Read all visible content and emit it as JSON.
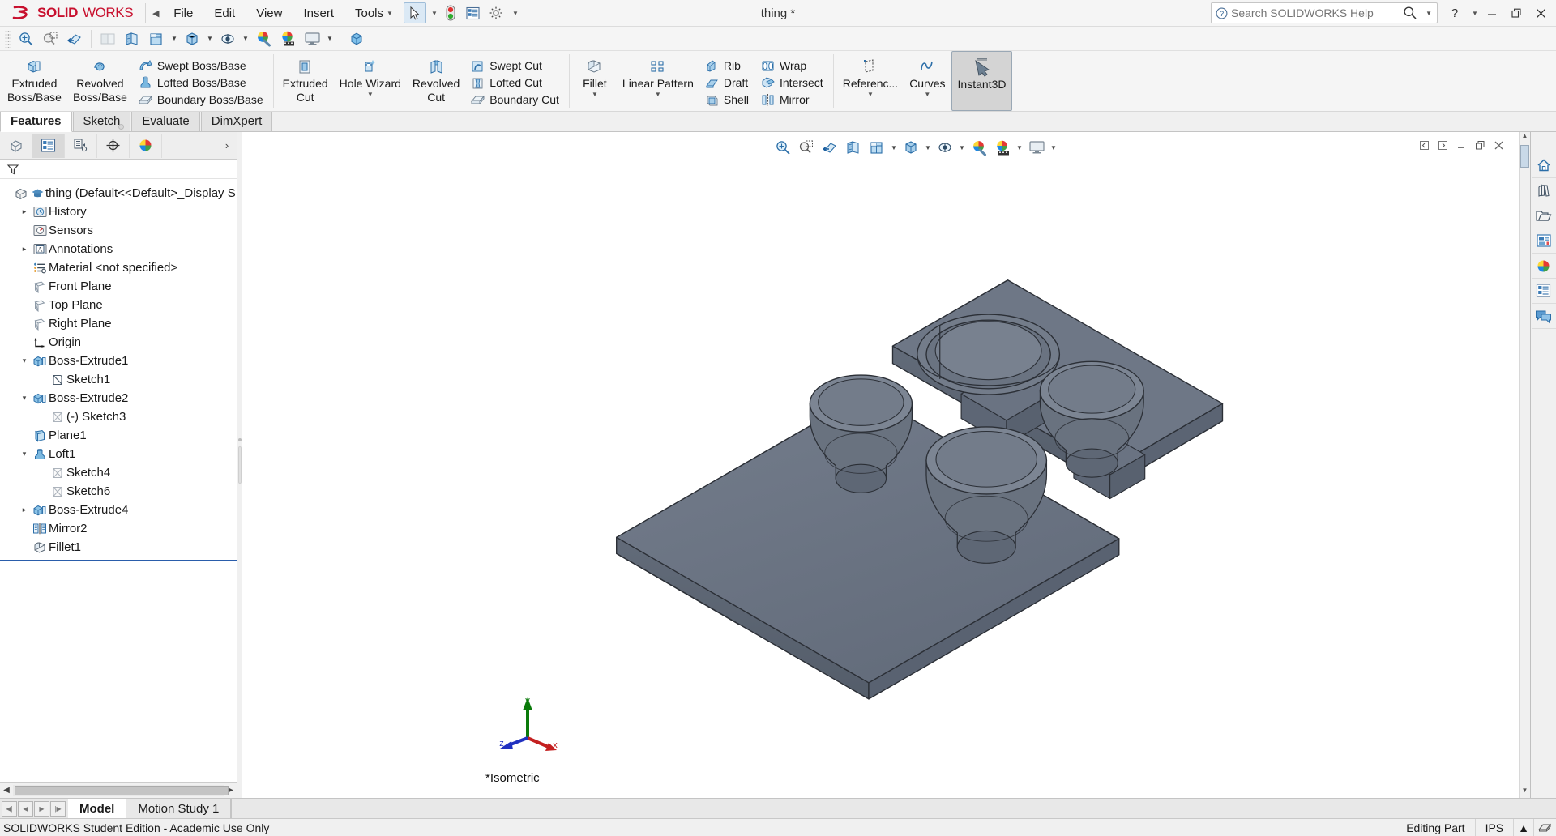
{
  "app": {
    "brand_ds": "2S",
    "brand_solid": "SOLID",
    "brand_works": "WORKS",
    "document_title": "thing *",
    "accent_red": "#c8102e",
    "accent_blue": "#2a5dab"
  },
  "menu": {
    "items": [
      {
        "label": "File"
      },
      {
        "label": "Edit"
      },
      {
        "label": "View"
      },
      {
        "label": "Insert"
      },
      {
        "label": "Tools"
      }
    ]
  },
  "search": {
    "placeholder": "Search SOLIDWORKS Help",
    "value": ""
  },
  "window_controls": {
    "help": "?",
    "minimize": "—",
    "restore": "❐",
    "close": "✕"
  },
  "ribbon": {
    "groups": [
      {
        "big": [
          {
            "label_line1": "Extruded",
            "label_line2": "Boss/Base",
            "icon": "extruded-boss-icon"
          },
          {
            "label_line1": "Revolved",
            "label_line2": "Boss/Base",
            "icon": "revolved-boss-icon"
          }
        ],
        "small": [
          {
            "label": "Swept Boss/Base",
            "icon": "swept-boss-icon"
          },
          {
            "label": "Lofted Boss/Base",
            "icon": "lofted-boss-icon"
          },
          {
            "label": "Boundary Boss/Base",
            "icon": "boundary-boss-icon"
          }
        ]
      },
      {
        "big": [
          {
            "label_line1": "Extruded",
            "label_line2": "Cut",
            "icon": "extruded-cut-icon"
          },
          {
            "label_line1": "Hole Wizard",
            "label_line2": "",
            "icon": "hole-wizard-icon",
            "dropdown": true
          },
          {
            "label_line1": "Revolved",
            "label_line2": "Cut",
            "icon": "revolved-cut-icon"
          }
        ],
        "small": [
          {
            "label": "Swept Cut",
            "icon": "swept-cut-icon"
          },
          {
            "label": "Lofted Cut",
            "icon": "lofted-cut-icon"
          },
          {
            "label": "Boundary Cut",
            "icon": "boundary-cut-icon"
          }
        ]
      },
      {
        "big": [
          {
            "label_line1": "Fillet",
            "label_line2": "",
            "icon": "fillet-icon",
            "dropdown": true
          },
          {
            "label_line1": "Linear Pattern",
            "label_line2": "",
            "icon": "linear-pattern-icon",
            "dropdown": true
          }
        ],
        "small": [
          {
            "label": "Rib",
            "icon": "rib-icon"
          },
          {
            "label": "Draft",
            "icon": "draft-icon"
          },
          {
            "label": "Shell",
            "icon": "shell-icon"
          }
        ],
        "small2": [
          {
            "label": "Wrap",
            "icon": "wrap-icon"
          },
          {
            "label": "Intersect",
            "icon": "intersect-icon"
          },
          {
            "label": "Mirror",
            "icon": "mirror-icon"
          }
        ]
      },
      {
        "big": [
          {
            "label_line1": "Referenc...",
            "label_line2": "",
            "icon": "reference-geometry-icon",
            "dropdown": true
          },
          {
            "label_line1": "Curves",
            "label_line2": "",
            "icon": "curves-icon",
            "dropdown": true
          },
          {
            "label_line1": "Instant3D",
            "label_line2": "",
            "icon": "instant3d-icon",
            "active": true
          }
        ]
      }
    ]
  },
  "command_tabs": {
    "items": [
      {
        "label": "Features",
        "active": true
      },
      {
        "label": "Sketch",
        "active": false
      },
      {
        "label": "Evaluate",
        "active": false
      },
      {
        "label": "DimXpert",
        "active": false
      }
    ]
  },
  "feature_manager": {
    "tabs": [
      {
        "name": "feature-manager-tab",
        "icon": "feature-tree-icon",
        "active": false
      },
      {
        "name": "property-manager-tab",
        "icon": "property-manager-icon",
        "active": true
      },
      {
        "name": "configuration-manager-tab",
        "icon": "configuration-icon",
        "active": false
      },
      {
        "name": "dimxpert-manager-tab",
        "icon": "dimxpert-icon",
        "active": false
      },
      {
        "name": "display-manager-tab",
        "icon": "appearance-icon",
        "active": false
      }
    ],
    "filter_icon": "filter-icon",
    "tree": [
      {
        "label": "thing  (Default<<Default>_Display S",
        "icon": "part-icon",
        "depth": 0,
        "twisty": "",
        "root": true
      },
      {
        "label": "History",
        "icon": "history-icon",
        "depth": 1,
        "twisty": "right"
      },
      {
        "label": "Sensors",
        "icon": "sensors-icon",
        "depth": 1,
        "twisty": ""
      },
      {
        "label": "Annotations",
        "icon": "annotations-icon",
        "depth": 1,
        "twisty": "right"
      },
      {
        "label": "Material <not specified>",
        "icon": "material-icon",
        "depth": 1,
        "twisty": ""
      },
      {
        "label": "Front Plane",
        "icon": "plane-icon",
        "depth": 1,
        "twisty": ""
      },
      {
        "label": "Top Plane",
        "icon": "plane-icon",
        "depth": 1,
        "twisty": ""
      },
      {
        "label": "Right Plane",
        "icon": "plane-icon",
        "depth": 1,
        "twisty": ""
      },
      {
        "label": "Origin",
        "icon": "origin-icon",
        "depth": 1,
        "twisty": ""
      },
      {
        "label": "Boss-Extrude1",
        "icon": "boss-extrude-icon",
        "depth": 1,
        "twisty": "down"
      },
      {
        "label": "Sketch1",
        "icon": "sketch-icon",
        "depth": 2,
        "twisty": ""
      },
      {
        "label": "Boss-Extrude2",
        "icon": "boss-extrude-icon",
        "depth": 1,
        "twisty": "down"
      },
      {
        "label": "(-) Sketch3",
        "icon": "sketch-gray-icon",
        "depth": 2,
        "twisty": ""
      },
      {
        "label": "Plane1",
        "icon": "plane1-icon",
        "depth": 1,
        "twisty": ""
      },
      {
        "label": "Loft1",
        "icon": "loft-icon",
        "depth": 1,
        "twisty": "down"
      },
      {
        "label": "Sketch4",
        "icon": "sketch-gray-icon",
        "depth": 2,
        "twisty": ""
      },
      {
        "label": "Sketch6",
        "icon": "sketch-gray-icon",
        "depth": 2,
        "twisty": ""
      },
      {
        "label": "Boss-Extrude4",
        "icon": "boss-extrude-icon",
        "depth": 1,
        "twisty": "right"
      },
      {
        "label": "Mirror2",
        "icon": "mirror-feature-icon",
        "depth": 1,
        "twisty": ""
      },
      {
        "label": "Fillet1",
        "icon": "fillet-feature-icon",
        "depth": 1,
        "twisty": ""
      }
    ]
  },
  "heads_up_toolbar": {
    "buttons": [
      {
        "name": "zoom-to-fit-icon"
      },
      {
        "name": "zoom-to-area-icon"
      },
      {
        "name": "previous-view-icon"
      },
      {
        "name": "section-view-icon"
      },
      {
        "name": "view-orientation-icon",
        "dropdown": true
      },
      {
        "name": "display-style-icon",
        "dropdown": true
      },
      {
        "name": "hide-show-items-icon",
        "dropdown": true
      },
      {
        "name": "edit-appearance-icon",
        "dropdown": true
      },
      {
        "name": "apply-scene-icon",
        "dropdown": true
      },
      {
        "name": "view-settings-icon",
        "dropdown": true
      }
    ]
  },
  "viewport": {
    "view_label": "*Isometric",
    "triad": {
      "x_label": "x",
      "y_label": "y",
      "z_label": "z"
    },
    "model_fill": "#6b7280",
    "model_fill_light": "#7c8694",
    "model_fill_dark": "#5a6472",
    "model_edge": "#2b2f36"
  },
  "task_pane": {
    "buttons": [
      {
        "name": "sw-resources-icon"
      },
      {
        "name": "design-library-icon"
      },
      {
        "name": "file-explorer-icon"
      },
      {
        "name": "view-palette-icon"
      },
      {
        "name": "appearances-scenes-icon"
      },
      {
        "name": "custom-properties-icon"
      },
      {
        "name": "sw-forum-icon"
      }
    ]
  },
  "bottom_tabs": {
    "nav": [
      "⏮",
      "◀",
      "▶",
      "⏭"
    ],
    "items": [
      {
        "label": "Model",
        "active": true
      },
      {
        "label": "Motion Study 1",
        "active": false
      }
    ]
  },
  "status_bar": {
    "left_text": "SOLIDWORKS Student Edition - Academic Use Only",
    "editing_state": "Editing Part",
    "units": "IPS",
    "units_caret": "▲",
    "overlay_icon": "overlay-icon"
  }
}
